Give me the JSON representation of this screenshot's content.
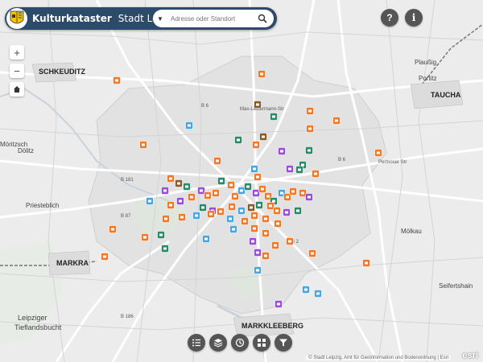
{
  "header": {
    "app_title": "Kulturkataster",
    "city": "Stadt Leipzig",
    "search_placeholder": "Adresse oder Standort"
  },
  "controls": {
    "help_label": "?",
    "info_label": "i",
    "zoom_in_label": "+",
    "zoom_out_label": "−"
  },
  "map_labels": {
    "schkeuditz": "SCHKEUDITZ",
    "taucha": "TAUCHA",
    "markranstaedt": "MARKRA",
    "markkleeberg": "MARKKLEEBERG",
    "leipziger_1": "Leipziger",
    "leipziger_2": "Tieflandsbucht",
    "moelkau": "Mölkau",
    "dolitz": "Dölitz",
    "priestablich": "Priesteblich",
    "plaussig": "Plaußig",
    "portitz": "Portitz",
    "moritzbach": "Möritzsch",
    "seifertshain": "Seifertshain"
  },
  "road_labels": [
    "B 6",
    "B 181",
    "B 87",
    "B 186",
    "B 2",
    "B 6",
    "Max-Liebermann-Str",
    "Permoser Str"
  ],
  "bottom_toolbar": [
    "list-icon",
    "layers-icon",
    "history-icon",
    "grid-icon",
    "filter-icon"
  ],
  "attribution": "© Stadt Leipzig, Amt für Geoinformation und Bodenordnung | Esri",
  "esri_logo": "esri",
  "colors": {
    "header": "#2c4a6a",
    "orange": "#f07a28",
    "purple": "#9a4fd6",
    "green": "#2a8a6a",
    "blue": "#4aa6e0",
    "brown": "#8a5a2a"
  }
}
